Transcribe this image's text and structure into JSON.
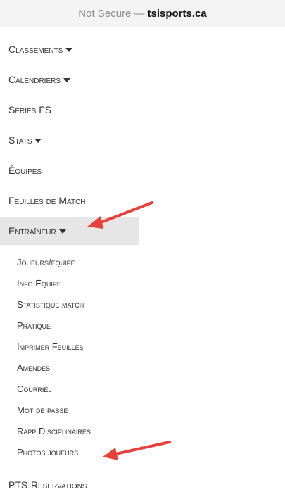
{
  "browser": {
    "security_label": "Not Secure —",
    "domain": "tsisports.ca"
  },
  "menu": {
    "items": [
      {
        "label": "Classements",
        "has_dropdown": true
      },
      {
        "label": "Calendriers",
        "has_dropdown": true
      },
      {
        "label": "Séries FS",
        "has_dropdown": false
      },
      {
        "label": "Stats",
        "has_dropdown": true
      },
      {
        "label": "Équipes",
        "has_dropdown": false
      },
      {
        "label": "Feuilles de Match",
        "has_dropdown": false
      },
      {
        "label": "Entraîneur",
        "has_dropdown": true,
        "active": true
      }
    ],
    "submenu": [
      "Joueurs/équipe",
      "Info Équipe",
      "Statistique match",
      "Pratique",
      "Imprimer Feuilles",
      "Amendes",
      "Courriel",
      "Mot de passe",
      "Rapp.Disciplinaires",
      "Photos joueurs"
    ],
    "after_submenu": {
      "label": "PTS-Reservations"
    }
  },
  "annotations": {
    "arrow_color": "#e8403a"
  }
}
